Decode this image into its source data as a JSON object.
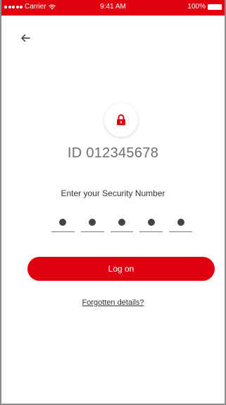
{
  "status_bar": {
    "carrier": "Carrier",
    "time": "9:41 AM",
    "battery": "100%"
  },
  "header": {
    "back_icon": "arrow-left-icon"
  },
  "lock": {
    "icon": "lock-icon"
  },
  "account": {
    "id_text": "ID 012345678"
  },
  "security": {
    "prompt": "Enter your Security Number",
    "digits_entered": 5,
    "digits_total": 5
  },
  "actions": {
    "logon_label": "Log on",
    "forgot_label": "Forgotten details?"
  },
  "colors": {
    "brand_red": "#e0000f",
    "text_gray": "#6e6e6e"
  }
}
